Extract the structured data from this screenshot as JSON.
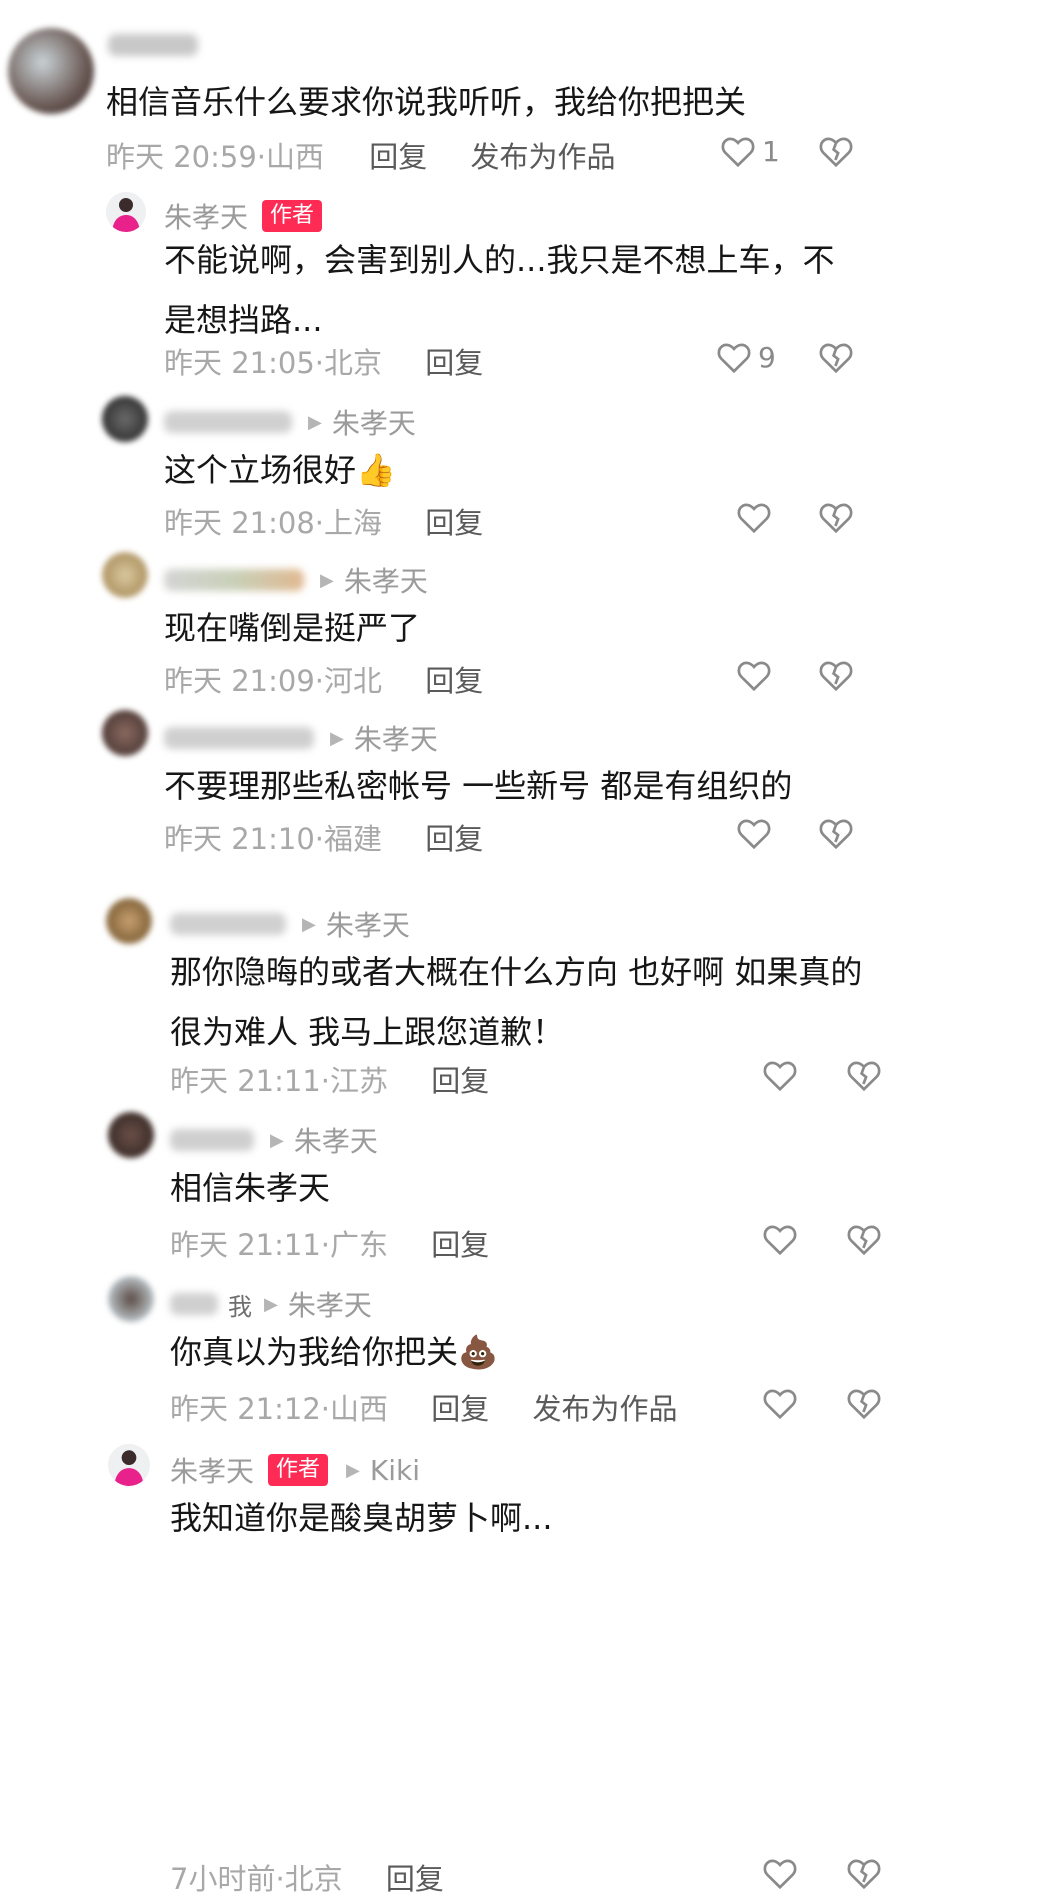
{
  "comments": [
    {
      "id": "c1",
      "author_badge": "",
      "reply_to": "",
      "text": "相信音乐什么要求你说我听听，我给你把把关",
      "time": "昨天 20:59",
      "location": "山西",
      "reply_label": "回复",
      "publish_label": "发布为作品",
      "likes": "1"
    },
    {
      "id": "c2",
      "username": "朱孝天",
      "author_badge": "作者",
      "text": "不能说啊，会害到别人的...我只是不想上车，不是想挡路...",
      "time": "昨天 21:05",
      "location": "北京",
      "reply_label": "回复",
      "likes": "9"
    },
    {
      "id": "c3",
      "reply_to": "朱孝天",
      "text": "这个立场很好👍",
      "time": "昨天 21:08",
      "location": "上海",
      "reply_label": "回复",
      "likes": ""
    },
    {
      "id": "c4",
      "reply_to": "朱孝天",
      "text": "现在嘴倒是挺严了",
      "time": "昨天 21:09",
      "location": "河北",
      "reply_label": "回复",
      "likes": ""
    },
    {
      "id": "c5",
      "reply_to": "朱孝天",
      "text": "不要理那些私密帐号 一些新号  都是有组织的",
      "time": "昨天 21:10",
      "location": "福建",
      "reply_label": "回复",
      "likes": ""
    },
    {
      "id": "c6",
      "reply_to": "朱孝天",
      "text": "那你隐晦的或者大概在什么方向 也好啊 如果真的很为难人 我马上跟您道歉！",
      "time": "昨天 21:11",
      "location": "江苏",
      "reply_label": "回复",
      "likes": ""
    },
    {
      "id": "c7",
      "reply_to": "朱孝天",
      "text": "相信朱孝天",
      "time": "昨天 21:11",
      "location": "广东",
      "reply_label": "回复",
      "likes": ""
    },
    {
      "id": "c8",
      "me_tag": "我",
      "reply_to": "朱孝天",
      "text": "你真以为我给你把关💩",
      "time": "昨天 21:12",
      "location": "山西",
      "reply_label": "回复",
      "publish_label": "发布为作品",
      "likes": ""
    },
    {
      "id": "c9",
      "username": "朱孝天",
      "author_badge": "作者",
      "reply_to": "Kiki",
      "text": "我知道你是酸臭胡萝卜啊...",
      "time": "7小时前",
      "location": "北京",
      "reply_label": "回复",
      "likes": ""
    }
  ],
  "icons": {
    "like": "heart-outline-icon",
    "dislike": "broken-heart-icon",
    "reply_arrow": "triangle-right-icon"
  },
  "colors": {
    "author_badge": "#fe2c55",
    "meta_text": "#a8a8a8",
    "body_text": "#161616"
  }
}
